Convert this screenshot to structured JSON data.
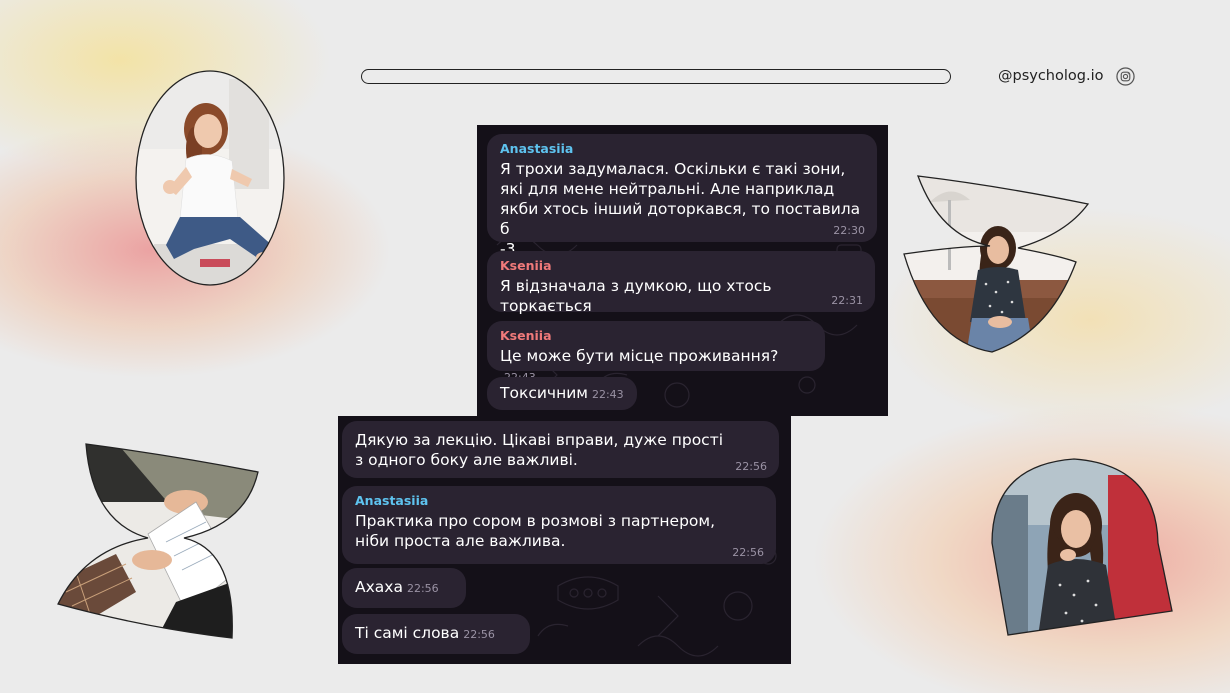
{
  "header": {
    "handle": "@psycholog.io",
    "handle_icon": "instagram-icon"
  },
  "colors": {
    "anastasiia": "#5ec3ef",
    "kseniia": "#f07a7a",
    "bubble": "#2a2331",
    "chat_bg": "#141018"
  },
  "chat_top": {
    "messages": [
      {
        "sender": "Anastasiia",
        "text": "Я трохи задумалася. Оскільки є такі зони,\nякі для мене нейтральні. Але наприклад\nякби хтось інший доторкався, то поставила б\n-3",
        "time": "22:30"
      },
      {
        "sender": "Kseniia",
        "text": "Я відзначала з думкою, що хтось торкається",
        "time": "22:31"
      },
      {
        "sender": "Kseniia",
        "text": "Це може бути місце проживання?",
        "time": "22:43"
      },
      {
        "sender": "",
        "text": "Токсичним",
        "time": "22:43"
      }
    ]
  },
  "chat_bottom": {
    "messages": [
      {
        "sender": "",
        "text": "Дякую за лекцію. Цікаві вправи, дуже прості\nз одного боку але важливі.",
        "time": "22:56"
      },
      {
        "sender": "Anastasiia",
        "text": "Практика про сором в розмові з партнером,\nніби проста але важлива.",
        "time": "22:56"
      },
      {
        "sender": "",
        "text": "Ахаха",
        "time": "22:56"
      },
      {
        "sender": "",
        "text": "Ті самі слова",
        "time": "22:56"
      }
    ]
  }
}
